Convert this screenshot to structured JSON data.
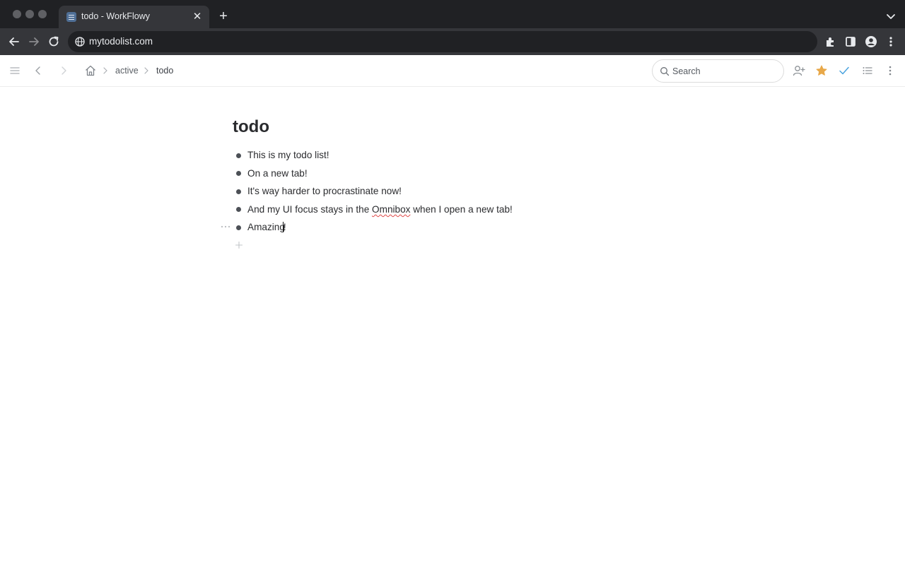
{
  "browser": {
    "tab_title": "todo - WorkFlowy",
    "tab_close": "✕",
    "new_tab": "+",
    "url": "mytodolist.com",
    "icons": [
      "back-arrow-icon",
      "forward-arrow-icon",
      "reload-icon",
      "globe-icon",
      "extensions-icon",
      "side-panel-icon",
      "profile-icon",
      "kebab-menu-icon",
      "tab-search-icon"
    ]
  },
  "header": {
    "breadcrumbs": [
      {
        "label": "active"
      },
      {
        "label": "todo"
      }
    ],
    "search_placeholder": "Search",
    "accent_star": "#e8a849",
    "accent_check": "#4aa3df"
  },
  "document": {
    "title": "todo",
    "items": [
      {
        "text": "This is my todo list!"
      },
      {
        "text": "On a new tab!"
      },
      {
        "text": "It's way harder to procrastinate now!"
      },
      {
        "pre": "And my UI focus stays in the ",
        "misspelled": "Omnibox",
        "post": " when I open a new tab!"
      },
      {
        "pre": "Amazing",
        "post": "!"
      }
    ]
  }
}
